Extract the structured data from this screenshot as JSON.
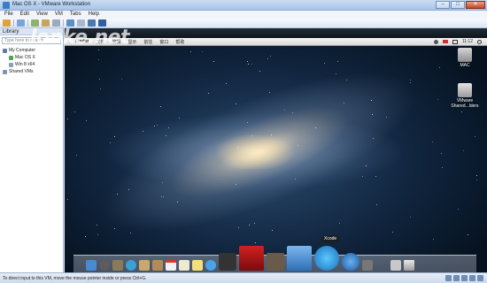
{
  "window": {
    "title": "Mac OS X - VMware Workstation",
    "min": "–",
    "max": "□",
    "close": "✕"
  },
  "menu": [
    "File",
    "Edit",
    "View",
    "VM",
    "Tabs",
    "Help"
  ],
  "watermark": "lonke.net",
  "library": {
    "header": "Library",
    "search_placeholder": "Type here to search",
    "tree": [
      {
        "label": "My Computer",
        "level": 0,
        "icon": "computer-icon"
      },
      {
        "label": "Mac OS X",
        "level": 1,
        "icon": "vm-running-icon"
      },
      {
        "label": "Win 8 x64",
        "level": 1,
        "icon": "vm-icon"
      },
      {
        "label": "Shared VMs",
        "level": 0,
        "icon": "shared-icon"
      }
    ]
  },
  "mac": {
    "menu": [
      "",
      "Finder",
      "文件",
      "编辑",
      "显示",
      "前往",
      "窗口",
      "帮助"
    ],
    "time": "11:12",
    "desktop_icons": [
      {
        "label": "MAC"
      },
      {
        "label": "VMware Shared...lders"
      }
    ],
    "dock_tooltip": "Xcode"
  },
  "status": {
    "message": "To direct input to this VM, move the mouse pointer inside or press Ctrl+G."
  },
  "colors": {
    "accent": "#3c7cc9",
    "vm_bg": "#0a1b2e"
  }
}
